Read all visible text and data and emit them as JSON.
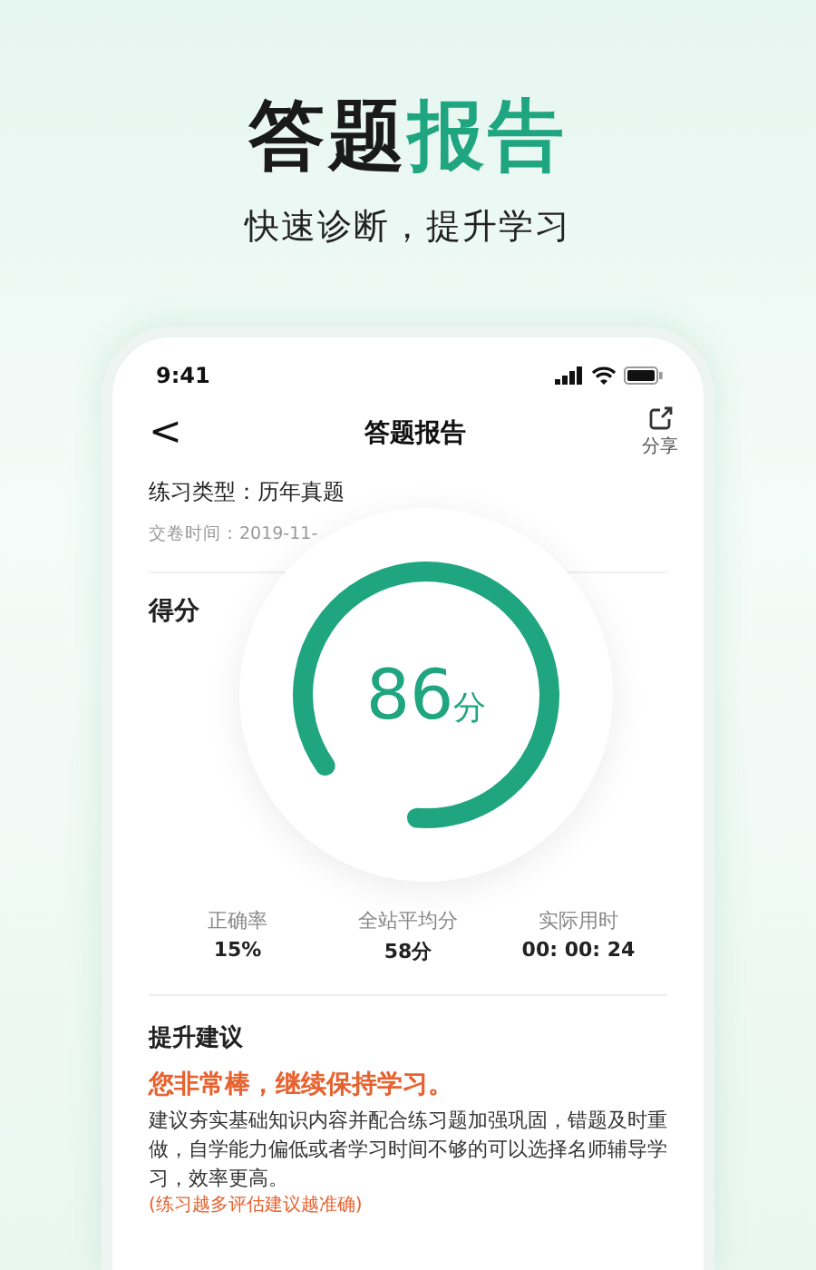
{
  "headline": {
    "title": "答题",
    "title_accent": "报告"
  },
  "subtitle": "快速诊断，提升学习",
  "status_bar": {
    "time": "9:41"
  },
  "nav": {
    "back": "<",
    "title": "答题报告",
    "share": "分享"
  },
  "info": {
    "practice_type": "练习类型：历年真题",
    "submit_time": "交卷时间：2019-11-"
  },
  "score": {
    "label": "得分",
    "value": "86",
    "unit": "分",
    "level": 0.86
  },
  "stats": [
    {
      "label": "正确率",
      "value": "15%"
    },
    {
      "label": "全站平均分",
      "value": "58分"
    },
    {
      "label": "实际用时",
      "value": "00: 00: 24"
    }
  ],
  "advice": {
    "title": "提升建议",
    "headline": "您非常棒，继续保持学习。",
    "body": "建议夯实基础知识内容并配合练习题加强巩固，错题及时重做，自学能力偏低或者学习时间不够的可以选择名师辅导学习，效率更高。",
    "note": "(练习越多评估建议越准确)"
  }
}
